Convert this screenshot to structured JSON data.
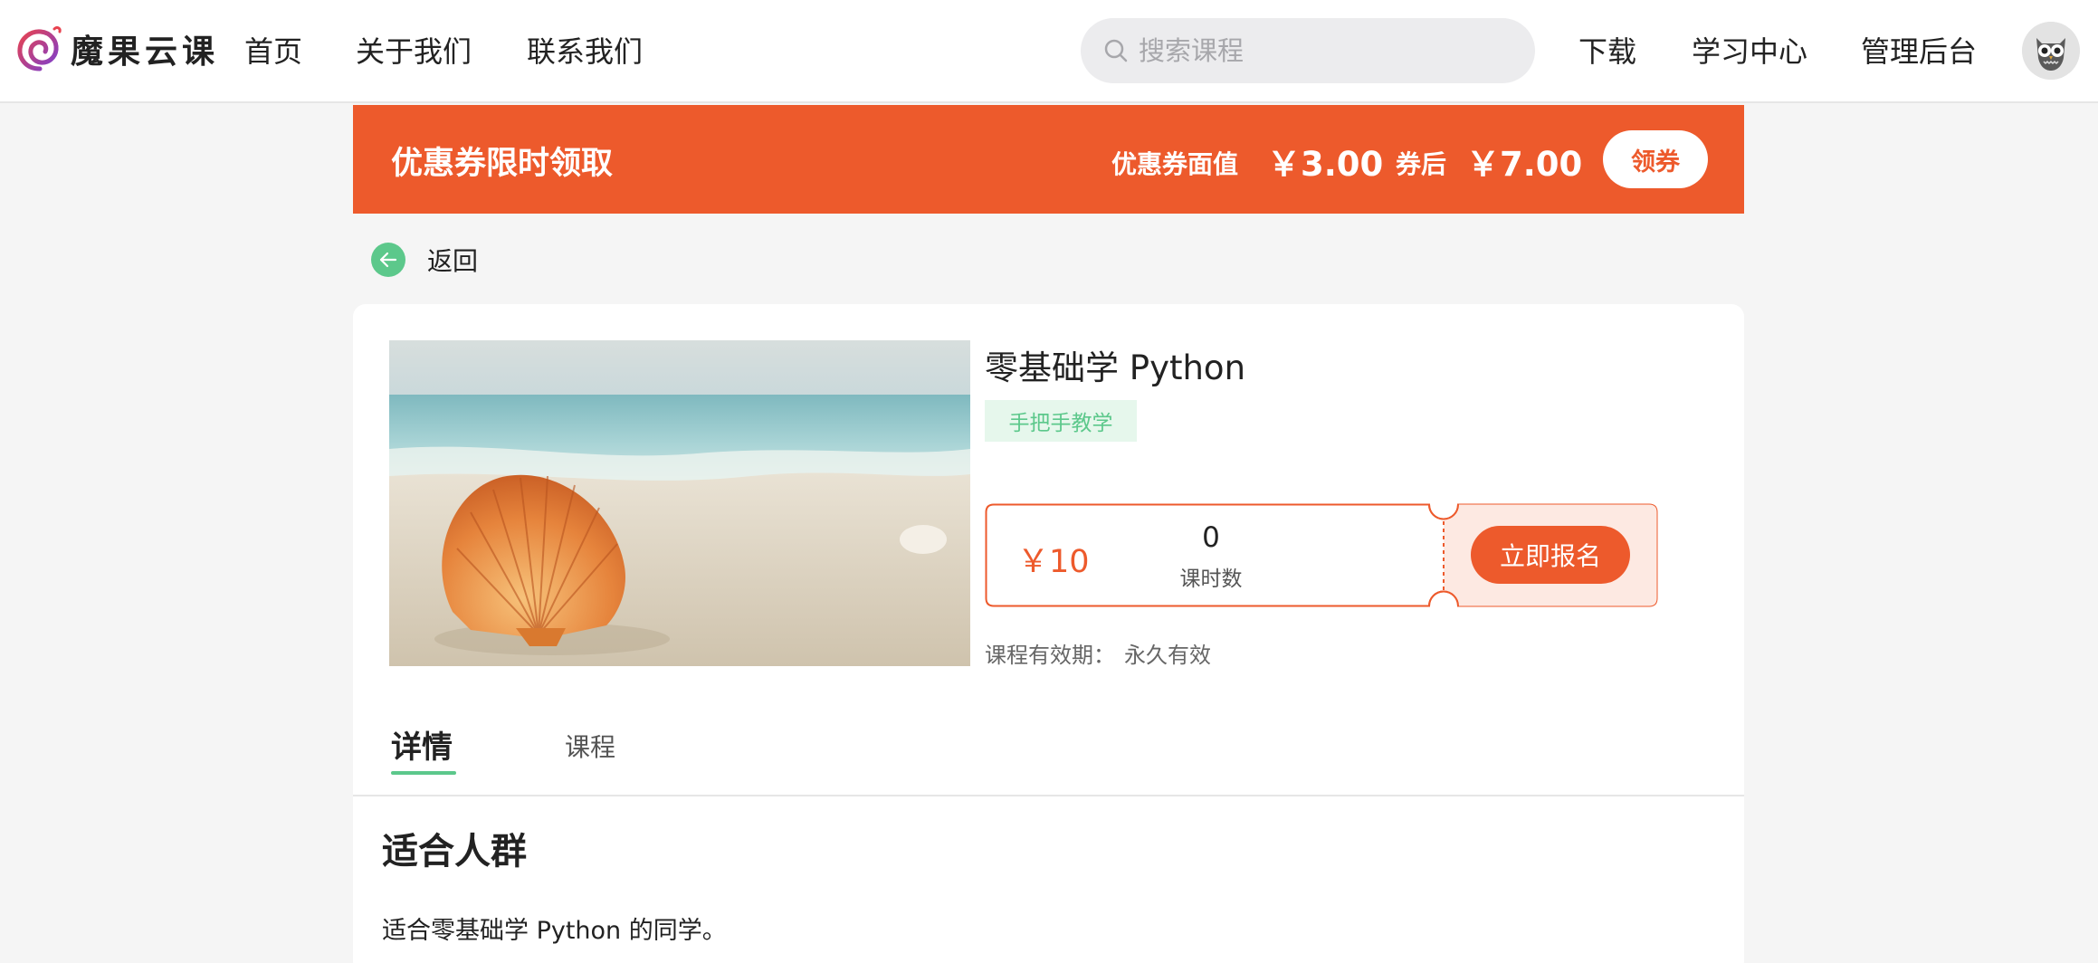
{
  "header": {
    "logo_text": "魔果云课",
    "nav": [
      "首页",
      "关于我们",
      "联系我们"
    ],
    "search_placeholder": "搜索课程",
    "links": [
      "下载",
      "学习中心",
      "管理后台"
    ]
  },
  "coupon": {
    "title": "优惠券限时领取",
    "face_label": "优惠券面值",
    "face_value": "￥3.00",
    "after_label": "券后",
    "after_value": "￥7.00",
    "button": "领券"
  },
  "back_label": "返回",
  "course": {
    "title": "零基础学 Python",
    "tag": "手把手教学",
    "price": "￥10",
    "lessons_count": "0",
    "lessons_label": "课时数",
    "enroll_button": "立即报名",
    "validity_label": "课程有效期：",
    "validity_value": "永久有效"
  },
  "tabs": [
    "详情",
    "课程"
  ],
  "detail": {
    "section_title": "适合人群",
    "section_text": "适合零基础学 Python 的同学。"
  },
  "colors": {
    "accent": "#ed5a2c",
    "green": "#5cc88b",
    "background": "#f5f5f5"
  }
}
